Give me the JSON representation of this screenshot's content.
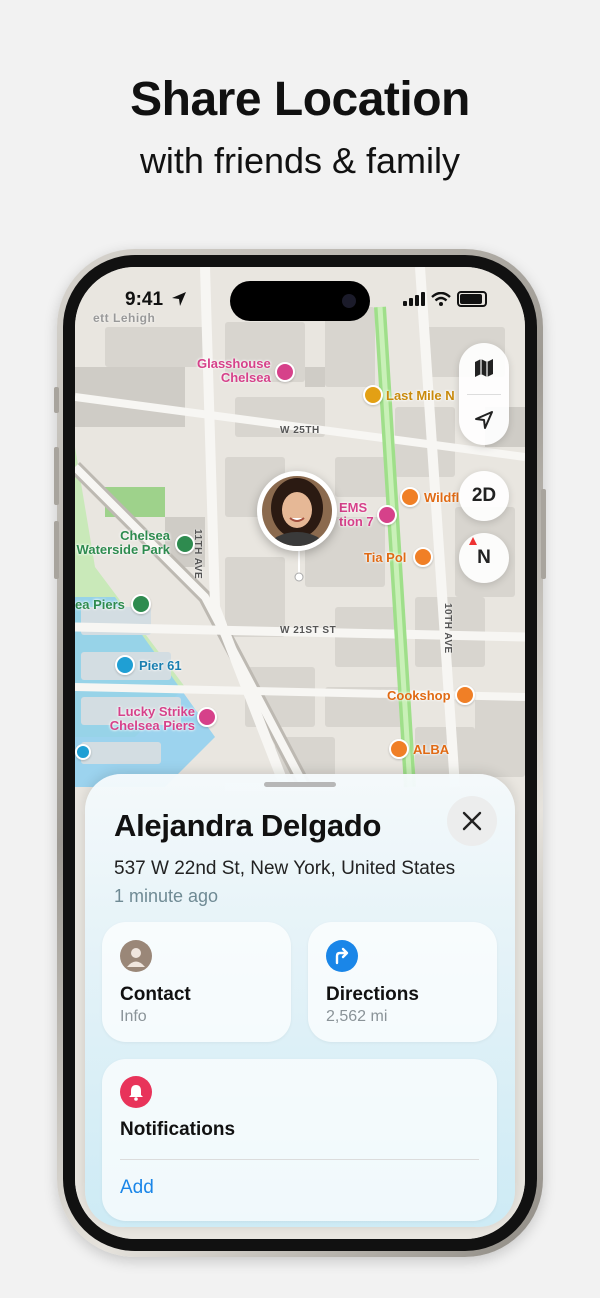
{
  "header": {
    "title": "Share Location",
    "subtitle": "with friends & family"
  },
  "status_bar": {
    "time": "9:41"
  },
  "map": {
    "controls": {
      "mode_2d_label": "2D",
      "compass_label": "N"
    },
    "pois": [
      {
        "name": "Glasshouse\nChelsea",
        "color": "#d6418a"
      },
      {
        "name": "Last Mile N",
        "color": "#e3a014"
      },
      {
        "name": "EMS\ntion 7",
        "color": "#d6418a"
      },
      {
        "name": "Wildfl",
        "color": "#f07f26"
      },
      {
        "name": "Tia Pol",
        "color": "#f07f26"
      },
      {
        "name": "Chelsea\nWaterside Park",
        "color": "#2e8b4f"
      },
      {
        "name": "ea Piers",
        "color": "#2e8b4f"
      },
      {
        "name": "Pier 61",
        "color": "#1f9fd4"
      },
      {
        "name": "Lucky Strike\nChelsea Piers",
        "color": "#d6418a"
      },
      {
        "name": "Cookshop",
        "color": "#f07f26"
      },
      {
        "name": "ALBA",
        "color": "#f07f26"
      }
    ],
    "streets": {
      "w25": "W 25TH",
      "w21": "W 21ST ST",
      "ave11": "11TH AVE",
      "ave10": "10TH AVE",
      "faded_label": "ett Lehigh"
    }
  },
  "sheet": {
    "name": "Alejandra Delgado",
    "address": "537 W 22nd St, New York, United States",
    "updated": "1 minute ago",
    "contact": {
      "title": "Contact",
      "subtitle": "Info"
    },
    "directions": {
      "title": "Directions",
      "subtitle": "2,562 mi"
    },
    "notifications": {
      "title": "Notifications",
      "action": "Add"
    }
  },
  "colors": {
    "accent": "#1a86e8",
    "notification": "#e8335a",
    "park": "#c9e9b9",
    "water": "#8ecff0",
    "road_green": "#9fdf8a"
  }
}
